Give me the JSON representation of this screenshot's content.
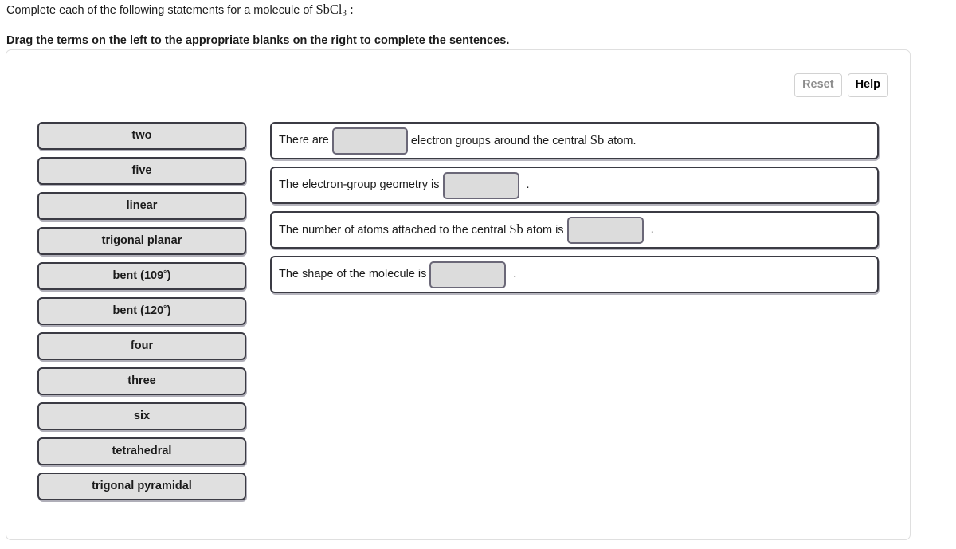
{
  "header": {
    "question_prefix": "Complete each of the following statements for a molecule of ",
    "formula_main": "SbCl",
    "formula_sub": "3",
    "formula_suffix": " :",
    "instruction": "Drag the terms on the left to the appropriate blanks on the right to complete the sentences."
  },
  "toolbar": {
    "reset_label": "Reset",
    "help_label": "Help"
  },
  "term_bank": {
    "terms": [
      {
        "label": "two"
      },
      {
        "label": "five"
      },
      {
        "label": "linear"
      },
      {
        "label": "trigonal planar"
      },
      {
        "label": "bent (109",
        "degree": "°",
        "label_end": ")"
      },
      {
        "label": "bent (120",
        "degree": "°",
        "label_end": ")"
      },
      {
        "label": "four"
      },
      {
        "label": "three"
      },
      {
        "label": "six"
      },
      {
        "label": "tetrahedral"
      },
      {
        "label": "trigonal pyramidal"
      }
    ]
  },
  "sentences": [
    {
      "text_before": "There are",
      "blank_value": "",
      "text_after": "electron groups around the central ",
      "formula_after": "Sb",
      "text_tail": " atom.",
      "period": ""
    },
    {
      "text_before": "The electron-group geometry is",
      "blank_value": "",
      "text_after": "",
      "formula_after": "",
      "text_tail": "",
      "period": "."
    },
    {
      "text_before": "The number of atoms attached to the central ",
      "formula_before": "Sb",
      "text_before_tail": " atom is",
      "blank_value": "",
      "text_after": "",
      "period": "."
    },
    {
      "text_before": "The shape of the molecule is",
      "blank_value": "",
      "text_after": "",
      "period": "."
    }
  ],
  "colors": {
    "chip_fill": "#e0e0e0",
    "chip_border": "#3b3b44",
    "blank_fill": "#dcdcdc",
    "blank_border": "#6b6878",
    "panel_border": "#dfdfdf",
    "reset_text": "#8c8c8c",
    "help_text": "#000000"
  }
}
